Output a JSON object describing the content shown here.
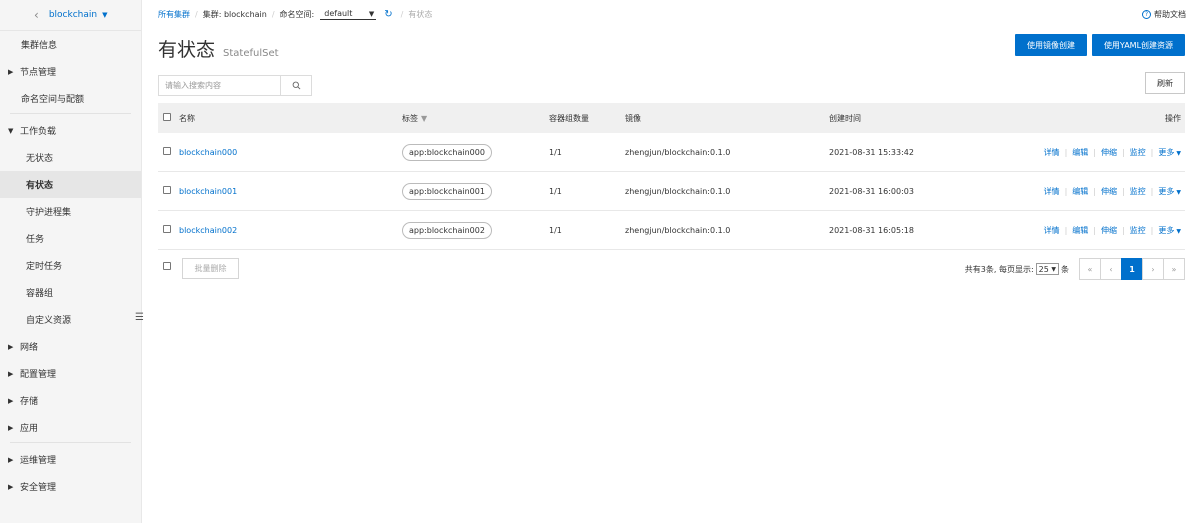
{
  "sidebar": {
    "cluster_name": "blockchain",
    "items": [
      {
        "label": "集群信息",
        "kind": "item"
      },
      {
        "label": "节点管理",
        "kind": "group-collapsed"
      },
      {
        "label": "命名空间与配额",
        "kind": "item"
      },
      {
        "label": "工作负载",
        "kind": "group-expanded"
      },
      {
        "label": "无状态",
        "kind": "sub"
      },
      {
        "label": "有状态",
        "kind": "sub-active"
      },
      {
        "label": "守护进程集",
        "kind": "sub"
      },
      {
        "label": "任务",
        "kind": "sub"
      },
      {
        "label": "定时任务",
        "kind": "sub"
      },
      {
        "label": "容器组",
        "kind": "sub"
      },
      {
        "label": "自定义资源",
        "kind": "sub"
      },
      {
        "label": "网络",
        "kind": "group-collapsed"
      },
      {
        "label": "配置管理",
        "kind": "group-collapsed"
      },
      {
        "label": "存储",
        "kind": "group-collapsed"
      },
      {
        "label": "应用",
        "kind": "group-collapsed"
      },
      {
        "label": "运维管理",
        "kind": "group-collapsed"
      },
      {
        "label": "安全管理",
        "kind": "group-collapsed"
      }
    ]
  },
  "breadcrumb": {
    "all_clusters": "所有集群",
    "cluster": "集群: blockchain",
    "namespace_label": "命名空间:",
    "namespace_value": "default",
    "current": "有状态"
  },
  "help_label": "帮助文档",
  "page": {
    "title": "有状态",
    "subtitle": "StatefulSet"
  },
  "buttons": {
    "create_from_image": "使用镜像创建",
    "create_from_yaml": "使用YAML创建资源",
    "refresh": "刷新",
    "batch_delete": "批量删除"
  },
  "search": {
    "placeholder": "请输入搜索内容"
  },
  "table": {
    "columns": {
      "name": "名称",
      "labels": "标签",
      "pod_count": "容器组数量",
      "image": "镜像",
      "created": "创建时间",
      "actions": "操作"
    },
    "rows": [
      {
        "name": "blockchain000",
        "label": "app:blockchain000",
        "pods": "1/1",
        "image": "zhengjun/blockchain:0.1.0",
        "created": "2021-08-31 15:33:42"
      },
      {
        "name": "blockchain001",
        "label": "app:blockchain001",
        "pods": "1/1",
        "image": "zhengjun/blockchain:0.1.0",
        "created": "2021-08-31 16:00:03"
      },
      {
        "name": "blockchain002",
        "label": "app:blockchain002",
        "pods": "1/1",
        "image": "zhengjun/blockchain:0.1.0",
        "created": "2021-08-31 16:05:18"
      }
    ],
    "row_actions": {
      "details": "详情",
      "edit": "编辑",
      "scale": "伸缩",
      "monitor": "监控",
      "more": "更多"
    }
  },
  "pagination": {
    "total_prefix": "共有3条, 每页显示:",
    "page_size": "25",
    "suffix": "条",
    "first": "«",
    "prev": "‹",
    "current": "1",
    "next": "›",
    "last": "»"
  },
  "colors": {
    "accent": "#0070cc"
  }
}
